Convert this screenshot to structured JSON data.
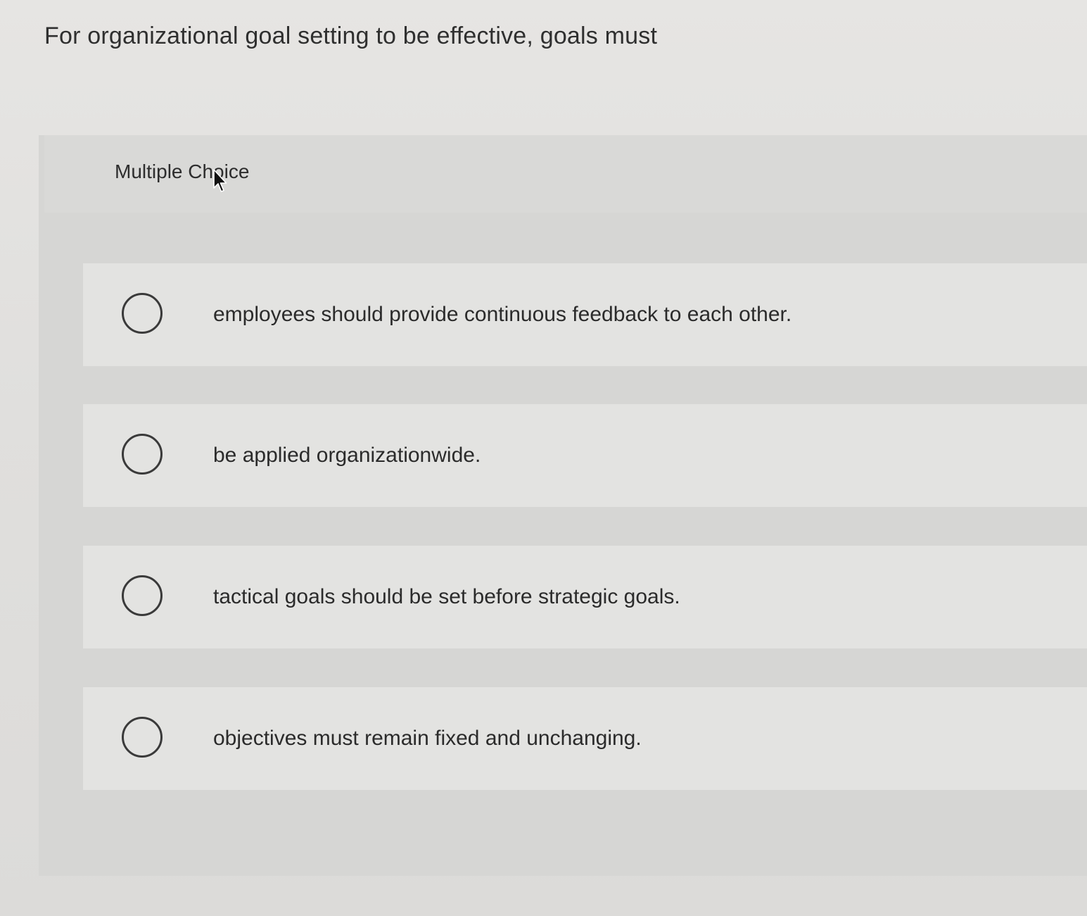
{
  "question": {
    "text": "For organizational goal setting to be effective, goals must"
  },
  "multiple_choice": {
    "label": "Multiple Choice",
    "options": [
      {
        "label": "employees should provide continuous feedback to each other.",
        "selected": false
      },
      {
        "label": "be applied organizationwide.",
        "selected": false
      },
      {
        "label": "tactical goals should be set before strategic goals.",
        "selected": false
      },
      {
        "label": "objectives must remain fixed and unchanging.",
        "selected": false
      }
    ]
  }
}
